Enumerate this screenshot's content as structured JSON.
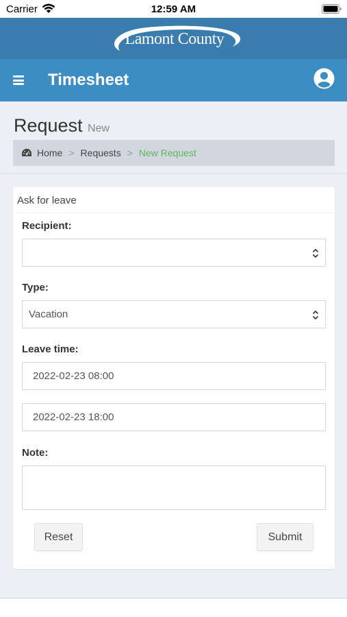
{
  "status_bar": {
    "carrier": "Carrier",
    "time": "12:59 AM"
  },
  "brand": {
    "logo_text": "Lamont County"
  },
  "nav": {
    "title": "Timesheet"
  },
  "page": {
    "title": "Request",
    "subtitle": "New"
  },
  "breadcrumb": {
    "home": "Home",
    "requests": "Requests",
    "current": "New Request",
    "separator": ">"
  },
  "form": {
    "header": "Ask for leave",
    "recipient_label": "Recipient:",
    "recipient_value": "",
    "type_label": "Type:",
    "type_value": "Vacation",
    "leave_time_label": "Leave time:",
    "leave_start": "2022-02-23 08:00",
    "leave_end": "2022-02-23 18:00",
    "note_label": "Note:",
    "note_value": "",
    "reset_label": "Reset",
    "submit_label": "Submit"
  },
  "colors": {
    "logo_bar": "#3a7cae",
    "nav_bar": "#3c8dc4",
    "content_bg": "#ecf0f5",
    "breadcrumb_active": "#5cb85c"
  }
}
